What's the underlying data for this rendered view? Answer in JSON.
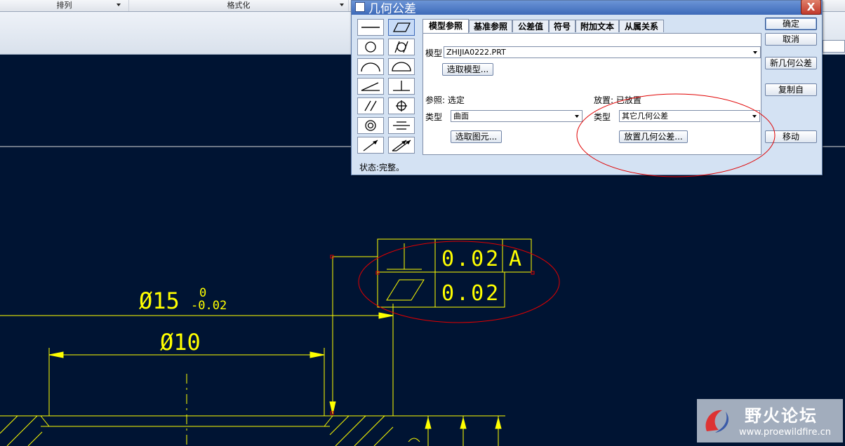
{
  "ribbon": {
    "groups": [
      "排列",
      "格式化"
    ]
  },
  "dialog": {
    "title": "几何公差",
    "close_label": "X",
    "tabs": [
      "模型参照",
      "基准参照",
      "公差值",
      "符号",
      "附加文本",
      "从属关系"
    ],
    "model_label": "模型",
    "model_value": "ZHIJIA0222.PRT",
    "select_model_button": "选取模型...",
    "reference_label": "参照: 选定",
    "ref_type_label": "类型",
    "ref_type_value": "曲面",
    "select_entity_button": "选取图元...",
    "placement_label": "放置: 已放置",
    "place_type_label": "类型",
    "place_type_value": "其它几何公差",
    "place_gtol_button": "放置几何公差...",
    "side_buttons": [
      "确定",
      "取消",
      "新几何公差",
      "复制自",
      "移动"
    ],
    "status": "状态:完整。",
    "palette_icons": [
      "straightness-icon",
      "flatness-icon",
      "circularity-icon",
      "cylindricity-icon",
      "line-profile-icon",
      "surface-profile-icon",
      "angularity-icon",
      "perpendicularity-icon",
      "parallelism-icon",
      "position-icon",
      "concentricity-icon",
      "symmetry-icon",
      "circular-runout-icon",
      "total-runout-icon"
    ]
  },
  "drawing": {
    "frame_row1_value": "0.02",
    "frame_row1_datum": "A",
    "frame_row2_value": "0.02",
    "dim1_label": "Ø15",
    "dim1_tol_upper": "0",
    "dim1_tol_lower": "-0.02",
    "dim2_label": "Ø10",
    "line_color": "#ffff00",
    "background_color": "#001433",
    "annotation_color": "#e00000"
  },
  "watermark": {
    "title": "野火论坛",
    "url": "www.proewildfire.cn"
  }
}
